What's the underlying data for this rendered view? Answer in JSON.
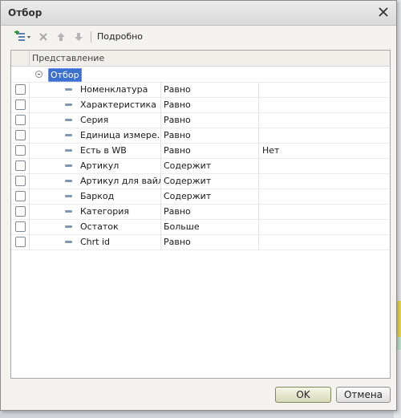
{
  "window": {
    "title": "Отбор"
  },
  "toolbar": {
    "details_label": "Подробно"
  },
  "grid": {
    "header_label": "Представление",
    "group_label": "Отбор",
    "rows": [
      {
        "field": "Номенклатура",
        "condition": "Равно",
        "value": ""
      },
      {
        "field": "Характеристика",
        "condition": "Равно",
        "value": ""
      },
      {
        "field": "Серия",
        "condition": "Равно",
        "value": ""
      },
      {
        "field": "Единица измере…",
        "condition": "Равно",
        "value": ""
      },
      {
        "field": "Есть в WB",
        "condition": "Равно",
        "value": "Нет"
      },
      {
        "field": "Артикул",
        "condition": "Содержит",
        "value": ""
      },
      {
        "field": "Артикул для вайл…",
        "condition": "Содержит",
        "value": ""
      },
      {
        "field": "Баркод",
        "condition": "Содержит",
        "value": ""
      },
      {
        "field": "Категория",
        "condition": "Равно",
        "value": ""
      },
      {
        "field": "Остаток",
        "condition": "Больше",
        "value": ""
      },
      {
        "field": "Chrt id",
        "condition": "Равно",
        "value": ""
      }
    ]
  },
  "footer": {
    "ok_label": "OK",
    "cancel_label": "Отмена"
  }
}
